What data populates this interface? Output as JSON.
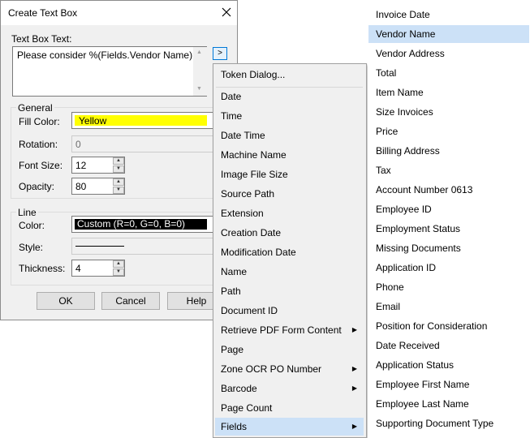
{
  "dialog": {
    "title": "Create Text Box",
    "text_box_label": "Text Box Text:",
    "text_box_value": "Please consider %(Fields.Vendor Name)",
    "token_button_label": ">",
    "general": {
      "title": "General",
      "fill_color_label": "Fill Color:",
      "fill_color_value": "Yellow",
      "rotation_label": "Rotation:",
      "rotation_value": "0",
      "font_size_label": "Font Size:",
      "font_size_value": "12",
      "opacity_label": "Opacity:",
      "opacity_value": "80"
    },
    "line": {
      "title": "Line",
      "color_label": "Color:",
      "color_value": "Custom (R=0, G=0, B=0)",
      "style_label": "Style:",
      "thickness_label": "Thickness:",
      "thickness_value": "4"
    },
    "buttons": {
      "ok": "OK",
      "cancel": "Cancel",
      "help": "Help"
    }
  },
  "colors": {
    "fill_yellow": "#ffff00",
    "highlight": "#cce1f7",
    "accent": "#0078d7"
  },
  "token_menu": {
    "items": [
      {
        "label": "Token Dialog..."
      },
      {
        "label": "Date"
      },
      {
        "label": "Time"
      },
      {
        "label": "Date Time"
      },
      {
        "label": "Machine Name"
      },
      {
        "label": "Image File Size"
      },
      {
        "label": "Source Path"
      },
      {
        "label": "Extension"
      },
      {
        "label": "Creation Date"
      },
      {
        "label": "Modification Date"
      },
      {
        "label": "Name"
      },
      {
        "label": "Path"
      },
      {
        "label": "Document ID"
      },
      {
        "label": "Retrieve PDF Form Content"
      },
      {
        "label": "Page"
      },
      {
        "label": "Zone OCR PO Number"
      },
      {
        "label": "Barcode"
      },
      {
        "label": "Page Count"
      },
      {
        "label": "Fields"
      }
    ]
  },
  "fields_menu": {
    "items": [
      {
        "label": "Invoice Date"
      },
      {
        "label": "Vendor Name"
      },
      {
        "label": "Vendor Address"
      },
      {
        "label": "Total"
      },
      {
        "label": "Item Name"
      },
      {
        "label": "Size Invoices"
      },
      {
        "label": "Price"
      },
      {
        "label": "Billing Address"
      },
      {
        "label": "Tax"
      },
      {
        "label": "Account Number 0613"
      },
      {
        "label": "Employee ID"
      },
      {
        "label": "Employment Status"
      },
      {
        "label": "Missing Documents"
      },
      {
        "label": "Application ID"
      },
      {
        "label": "Phone"
      },
      {
        "label": "Email"
      },
      {
        "label": "Position for Consideration"
      },
      {
        "label": "Date Received"
      },
      {
        "label": "Application Status"
      },
      {
        "label": "Employee First Name"
      },
      {
        "label": "Employee Last Name"
      },
      {
        "label": "Supporting Document Type"
      }
    ]
  }
}
